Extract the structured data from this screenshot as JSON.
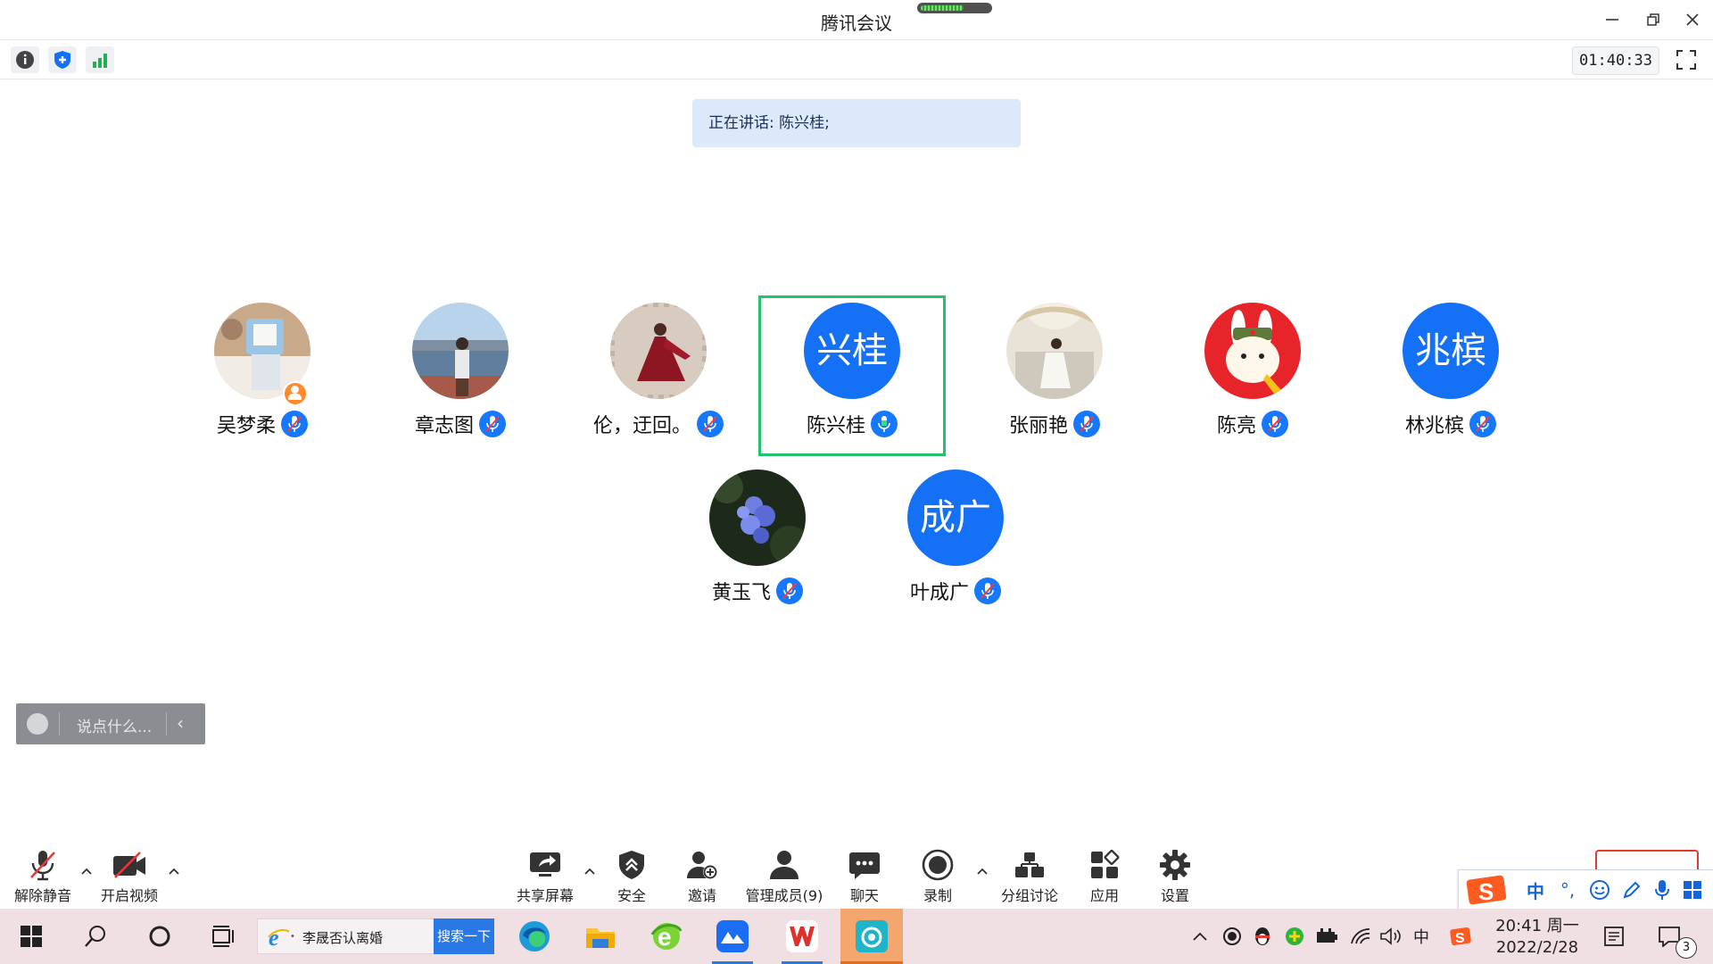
{
  "window": {
    "title": "腾讯会议"
  },
  "toolbar": {
    "timer": "01:40:33"
  },
  "speaking": {
    "text": "正在讲话: 陈兴桂;"
  },
  "participants": [
    {
      "name": "吴梦柔",
      "avatar": "photo",
      "host": true,
      "mic": "muted"
    },
    {
      "name": "章志图",
      "avatar": "photo",
      "mic": "muted"
    },
    {
      "name": "伦，迂回。",
      "avatar": "photo",
      "mic": "muted"
    },
    {
      "name": "陈兴桂",
      "avatar_text": "兴桂",
      "mic": "speaking",
      "active": true
    },
    {
      "name": "张丽艳",
      "avatar": "photo",
      "mic": "muted"
    },
    {
      "name": "陈亮",
      "avatar": "photo",
      "mic": "muted"
    },
    {
      "name": "林兆槟",
      "avatar_text": "兆槟",
      "mic": "muted"
    },
    {
      "name": "黄玉飞",
      "avatar": "photo",
      "mic": "muted"
    },
    {
      "name": "叶成广",
      "avatar_text": "成广",
      "mic": "muted"
    }
  ],
  "chat": {
    "placeholder": "说点什么..."
  },
  "controls": {
    "unmute": "解除静音",
    "start_video": "开启视频",
    "share_screen": "共享屏幕",
    "security": "安全",
    "invite": "邀请",
    "manage_members": "管理成员(9)",
    "chat": "聊天",
    "record": "录制",
    "breakout": "分组讨论",
    "apps": "应用",
    "settings": "设置"
  },
  "ime": {
    "lang": "中"
  },
  "taskbar": {
    "search_text": "李晟否认离婚",
    "search_button": "搜索一下",
    "tray_lang": "中",
    "time": "20:41 周一",
    "date": "2022/2/28",
    "notification_count": "3"
  },
  "colors": {
    "accent": "#1470f5",
    "active_border": "#21c36b",
    "banner_bg": "#dbe9fb",
    "taskbar_bg": "#f0dfe3"
  }
}
